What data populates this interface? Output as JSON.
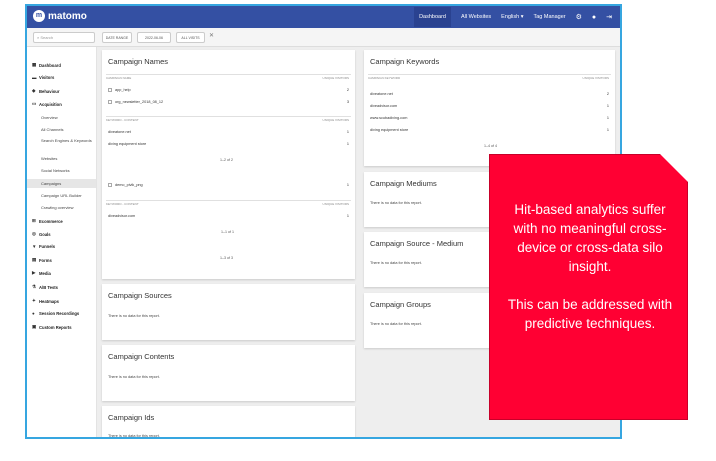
{
  "app": {
    "logo_text": "matomo",
    "nav": [
      "Dashboard",
      "All Websites",
      "English ▾",
      "Tag Manager"
    ]
  },
  "toolbar": {
    "search_placeholder": "Search",
    "period_button": "DATE RANGE",
    "date_button": "2022-06-06",
    "segment_button": "ALL VISITS"
  },
  "sidebar": {
    "items": [
      {
        "label": "Dashboard",
        "icon": "dashboard-icon"
      },
      {
        "label": "Visitors",
        "icon": "visitors-icon"
      },
      {
        "label": "Behaviour",
        "icon": "behaviour-icon"
      },
      {
        "label": "Acquisition",
        "icon": "acquisition-icon"
      }
    ],
    "sub_items": [
      "Overview",
      "All Channels",
      "Search Engines & Keywords",
      "Websites",
      "Social Networks",
      "Campaigns",
      "Campaign URL Builder",
      "Crawling overview"
    ],
    "bottom_items": [
      {
        "label": "Ecommerce",
        "icon": "ecommerce-icon"
      },
      {
        "label": "Goals",
        "icon": "goals-icon"
      },
      {
        "label": "Funnels",
        "icon": "funnels-icon"
      },
      {
        "label": "Forms",
        "icon": "forms-icon"
      },
      {
        "label": "Media",
        "icon": "media-icon"
      },
      {
        "label": "A/B Tests",
        "icon": "ab-tests-icon"
      },
      {
        "label": "Heatmaps",
        "icon": "heatmaps-icon"
      },
      {
        "label": "Session Recordings",
        "icon": "session-recordings-icon"
      },
      {
        "label": "Custom Reports",
        "icon": "custom-reports-icon"
      }
    ]
  },
  "campaign_names": {
    "title": "Campaign Names",
    "col_label": "CAMPAIGN NAME",
    "col_value": "UNIQUE VISITORS",
    "rows": [
      {
        "label": "app_help",
        "value": "2"
      },
      {
        "label": "org_newsletter_2018_08_12",
        "value": "3"
      }
    ],
    "sub1_col_label": "KEYWORD - CONTENT",
    "sub1_col_value": "UNIQUE VISITORS",
    "sub1_rows": [
      {
        "label": "diveatone.net",
        "value": "1"
      },
      {
        "label": "diving equipment store",
        "value": "1"
      }
    ],
    "sub1_pager": "1–2 of 2",
    "row3": {
      "label": "demo_pivik_png",
      "value": "1"
    },
    "sub2_col_label": "KEYWORD - CONTENT",
    "sub2_col_value": "UNIQUE VISITORS",
    "sub2_rows": [
      {
        "label": "diveadvisor.com",
        "value": "1"
      }
    ],
    "sub2_pager": "1–1 of 1",
    "pager": "1–3 of 3"
  },
  "campaign_keywords": {
    "title": "Campaign Keywords",
    "col_label": "CAMPAIGN KEYWORD",
    "col_value": "UNIQUE VISITORS",
    "rows": [
      {
        "label": "diveatone.net",
        "value": "2"
      },
      {
        "label": "diveadvisor.com",
        "value": "1"
      },
      {
        "label": "www.scubadiving.com",
        "value": "1"
      },
      {
        "label": "diving equipment store",
        "value": "1"
      }
    ],
    "pager": "1–4 of 4"
  },
  "campaign_mediums": {
    "title": "Campaign Mediums",
    "nodata": "There is no data for this report."
  },
  "campaign_source_medium": {
    "title": "Campaign Source - Medium",
    "nodata": "There is no data for this report."
  },
  "campaign_groups": {
    "title": "Campaign Groups",
    "nodata": "There is no data for this report."
  },
  "campaign_sources": {
    "title": "Campaign Sources",
    "nodata": "There is no data for this report."
  },
  "campaign_contents": {
    "title": "Campaign Contents",
    "nodata": "There is no data for this report."
  },
  "campaign_ids": {
    "title": "Campaign Ids",
    "nodata": "There is no data for this report."
  },
  "callout": {
    "text1": "Hit-based analytics suffer with no meaningful cross-device or cross-data silo insight.",
    "text2": "This can be addressed with predictive techniques.",
    "color": "#ff0033"
  }
}
